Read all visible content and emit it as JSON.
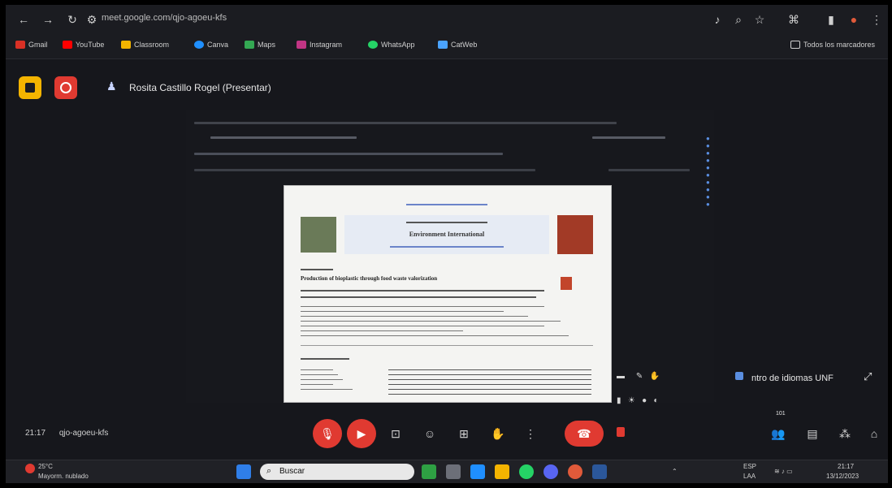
{
  "browser": {
    "url": "meet.google.com/qjo-agoeu-kfs",
    "bookmarks": [
      {
        "label": "Gmail",
        "color": "#d93025"
      },
      {
        "label": "YouTube",
        "color": "#ff0000"
      },
      {
        "label": "Classroom",
        "color": "#f4b400"
      },
      {
        "label": "Canva",
        "color": "#1f8fff"
      },
      {
        "label": "Maps",
        "color": "#34a853"
      },
      {
        "label": "Instagram",
        "color": "#c13584"
      },
      {
        "label": "WhatsApp",
        "color": "#25d366"
      },
      {
        "label": "CatWeb",
        "color": "#4aa3ff"
      }
    ],
    "all_bookmarks": "Todos los marcadores"
  },
  "meet": {
    "presenter": "Rosita Castillo Rogel (Presentar)",
    "time": "21:17",
    "meeting_code": "qjo-agoeu-kfs",
    "floating_label": "ntro de idiomas UNF",
    "floating_count": "101"
  },
  "paper": {
    "title_bar": "Environment International",
    "article_title": "Production of bioplastic through food waste valorization"
  },
  "taskbar": {
    "search_placeholder": "Buscar",
    "weather": "25°C",
    "weather_sub": "Mayorm. nublado",
    "lang": "ESP",
    "lang_sub": "LAA",
    "clock": "21:17",
    "date": "13/12/2023"
  },
  "colors": {
    "accent_red": "#e03a31",
    "yellow": "#f4b400",
    "panel": "#16171c"
  }
}
